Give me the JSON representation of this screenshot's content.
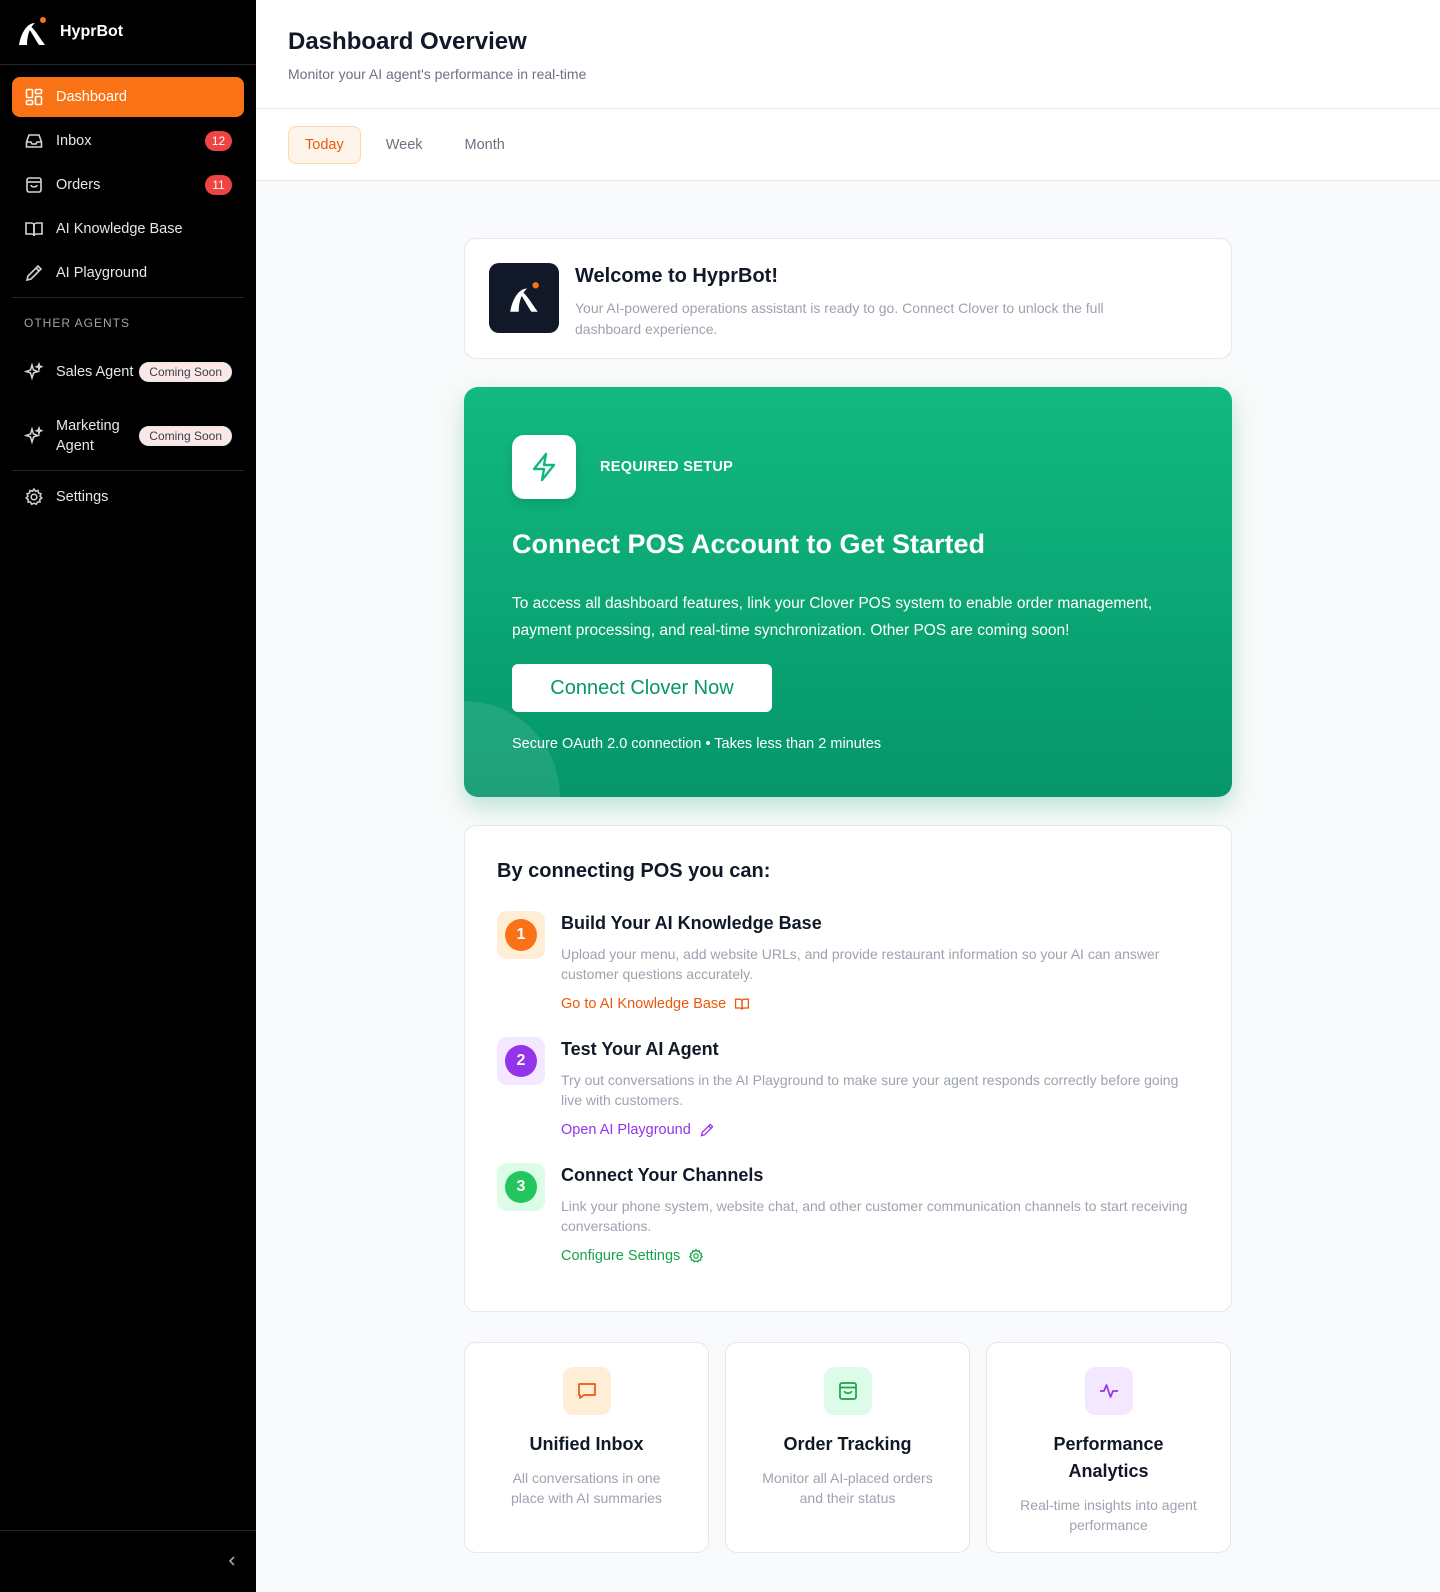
{
  "app": {
    "name": "HyprBot"
  },
  "sidebar": {
    "items": [
      {
        "label": "Dashboard",
        "icon": "dashboard-icon",
        "active": true
      },
      {
        "label": "Inbox",
        "icon": "inbox-icon",
        "badge": "12"
      },
      {
        "label": "Orders",
        "icon": "shopping-bag-icon",
        "badge": "11"
      },
      {
        "label": "AI Knowledge Base",
        "icon": "book-icon"
      },
      {
        "label": "AI Playground",
        "icon": "pencil-icon"
      }
    ],
    "section_label": "OTHER AGENTS",
    "agents": [
      {
        "label": "Sales Agent",
        "badge": "Coming Soon",
        "icon": "sparkles-icon"
      },
      {
        "label": "Marketing Agent",
        "badge": "Coming Soon",
        "icon": "sparkles-icon"
      }
    ],
    "settings_label": "Settings"
  },
  "header": {
    "title": "Dashboard Overview",
    "subtitle": "Monitor your AI agent's performance in real-time"
  },
  "tabs": [
    {
      "label": "Today",
      "active": true
    },
    {
      "label": "Week"
    },
    {
      "label": "Month"
    }
  ],
  "welcome": {
    "title": "Welcome to HyprBot!",
    "description": "Your AI-powered operations assistant is ready to go. Connect Clover to unlock the full dashboard experience."
  },
  "setup": {
    "tag": "REQUIRED SETUP",
    "title": "Connect POS Account to Get Started",
    "description": "To access all dashboard features, link your Clover POS system to enable order management, payment processing, and real-time synchronization. Other POS are coming soon!",
    "button_label": "Connect Clover Now",
    "note": "Secure OAuth 2.0 connection • Takes less than 2 minutes"
  },
  "benefits": {
    "title": "By connecting POS you can:",
    "steps": [
      {
        "number": "1",
        "title": "Build Your AI Knowledge Base",
        "description": "Upload your menu, add website URLs, and provide restaurant information so your AI can answer customer questions accurately.",
        "link": "Go to AI Knowledge Base",
        "link_icon": "book-icon",
        "color": "#f97316"
      },
      {
        "number": "2",
        "title": "Test Your AI Agent",
        "description": "Try out conversations in the AI Playground to make sure your agent responds correctly before going live with customers.",
        "link": "Open AI Playground",
        "link_icon": "pencil-icon",
        "color": "#9333ea"
      },
      {
        "number": "3",
        "title": "Connect Your Channels",
        "description": "Link your phone system, website chat, and other customer communication channels to start receiving conversations.",
        "link": "Configure Settings",
        "link_icon": "gear-icon",
        "color": "#22c55e"
      }
    ]
  },
  "features": [
    {
      "title": "Unified Inbox",
      "description": "All conversations in one place with AI summaries",
      "icon": "message-square-icon",
      "color": "#ea580c"
    },
    {
      "title": "Order Tracking",
      "description": "Monitor all AI-placed orders and their status",
      "icon": "shopping-bag-icon",
      "color": "#16a34a"
    },
    {
      "title": "Performance Analytics",
      "description": "Real-time insights into agent performance",
      "icon": "activity-icon",
      "color": "#9333ea"
    }
  ],
  "colors": {
    "accent": "#f97316",
    "success": "#10b981",
    "danger": "#ef4444",
    "purple": "#9333ea"
  }
}
